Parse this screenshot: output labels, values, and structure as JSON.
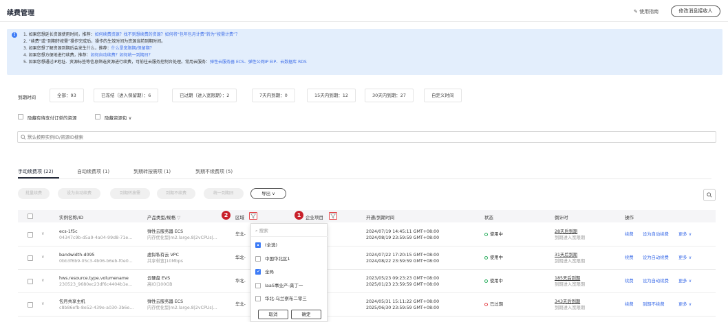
{
  "header": {
    "title": "续费管理",
    "guide_label": "使用指南",
    "receiver_button": "修改消息接收人"
  },
  "notice": {
    "lines": [
      {
        "parts": [
          "1. 如果您想延长资源使用时间，推荐：",
          "如何续费资源？找不到想续费的资源？如何将“包年包月计费”转为“按需计费”？"
        ]
      },
      {
        "parts": [
          "2. “续费”或“到期转按需”操作完成后，操作的生效时间为资源当前到期时间。",
          ""
        ]
      },
      {
        "parts": [
          "3. 如果您想了解资源到期后会发生什么，推荐：",
          "什么是宽限期/保留期？"
        ]
      },
      {
        "parts": [
          "4. 如果您想方便地进行续费，推荐：",
          "如何自动续费？如何统一到期日？"
        ]
      },
      {
        "parts": [
          "5. 如果您想通过IP地址、资源标签等信息筛选资源进行续费，可前往云服务控制台处理。常用云服务：",
          "弹性云服务器 ECS、弹性公网IP EIP、云数据库 RDS"
        ]
      }
    ]
  },
  "filters": {
    "expiry_label": "到期时间",
    "chips": [
      "全部：93",
      "已冻结（进入保留期）：6",
      "已过期（进入宽限期）：2",
      "7天内到期：0",
      "15天内到期：12",
      "30天内到期：27",
      "自定义时间"
    ],
    "hide_pending_order": "隐藏有待支付订单的资源",
    "hide_resource_pack": "隐藏资源包",
    "search_placeholder": "默认按照实例ID/资源ID搜索"
  },
  "tabs": [
    "手动续费项 (22)",
    "自动续费项 (1)",
    "到期转按需项 (1)",
    "到期不续费项 (5)"
  ],
  "actions": {
    "batch_renew": "批量续费",
    "set_auto": "设为自动续费",
    "to_ondemand": "到期转按需",
    "no_renew": "到期不续费",
    "unify_date": "统一到期日",
    "export": "导出"
  },
  "columns": [
    "实例名称/ID",
    "产品类型/规格",
    "区域",
    "企业项目",
    "开通/到期时间",
    "状态",
    "倒计时",
    "操作"
  ],
  "rows": [
    {
      "name": "ecs-1f5c",
      "id": "04347c9b-d5a9-4a04-99d8-71e...",
      "type": "弹性云服务器 ECS",
      "spec": "内存优化型|m2.large.8|2vCPUs|...",
      "region": "华北-",
      "open": "2024/07/19 14:45:11 GMT+08:00",
      "expire": "2024/08/19 23:59:59 GMT+08:00",
      "status": "使用中",
      "status_color": "#2bae5e",
      "countdown": "28天后到期",
      "countdown_note": "到期进入宽限期",
      "op1": "续费",
      "op2": "设为自动续费",
      "op3": "更多"
    },
    {
      "name": "bandwidth-d095",
      "id": "0bb3f6b9-05c3-4b06-b6eb-f0e0...",
      "type": "虚拟私有云 VPC",
      "spec": "共享带宽|10Mbps",
      "region": "华北-",
      "open": "2024/07/22 17:20:15 GMT+08:00",
      "expire": "2024/08/22 23:59:59 GMT+08:00",
      "status": "使用中",
      "status_color": "#2bae5e",
      "countdown": "31天后到期",
      "countdown_note": "到期进入宽限期",
      "op1": "续费",
      "op2": "设为自动续费",
      "op3": "更多"
    },
    {
      "name": "hws.resource.type.volumename",
      "id": "230523_9680ec23df6c4404b1e...",
      "type": "云硬盘 EVS",
      "spec": "高IO|100GB",
      "region": "华北-",
      "open": "2023/05/23 09:23:23 GMT+08:00",
      "expire": "2025/01/23 23:59:59 GMT+08:00",
      "status": "使用中",
      "status_color": "#2bae5e",
      "countdown": "185天后到期",
      "countdown_note": "到期进入宽限期",
      "op1": "续费",
      "op2": "设为自动续费",
      "op3": "更多"
    },
    {
      "name": "包月共享主机",
      "id": "c8b86efb-8e52-439e-a030-3b6e...",
      "type": "弹性云服务器 ECS",
      "spec": "内存优化型|m2.large.8|2vCPUs|...",
      "region": "华北-",
      "open": "2024/05/31 15:11:22 GMT+08:00",
      "expire": "2025/06/30 23:59:59 GMT+08:00",
      "status": "已过期",
      "status_color": "#e5484d",
      "countdown": "343天后到期",
      "countdown_note": "到期进入宽限期",
      "op1": "续费",
      "op2": "到期不续费",
      "op3": "更多"
    }
  ],
  "dropdown": {
    "search_placeholder": "搜索",
    "options": [
      {
        "label": "(全选)",
        "state": "partial"
      },
      {
        "label": "中国华北区1",
        "state": "unchecked"
      },
      {
        "label": "全局",
        "state": "checked"
      },
      {
        "label": "IaaS事业产-龚丁一",
        "state": "unchecked"
      },
      {
        "label": "华北-乌兰察布二零三",
        "state": "unchecked"
      }
    ],
    "cancel": "取消",
    "confirm": "确定"
  },
  "badges": [
    "1",
    "2"
  ],
  "colors": {
    "link": "#3e6ee8",
    "accent": "#3e7cf6",
    "badge": "#c8202b",
    "ok": "#2bae5e",
    "expired": "#e5484d"
  }
}
